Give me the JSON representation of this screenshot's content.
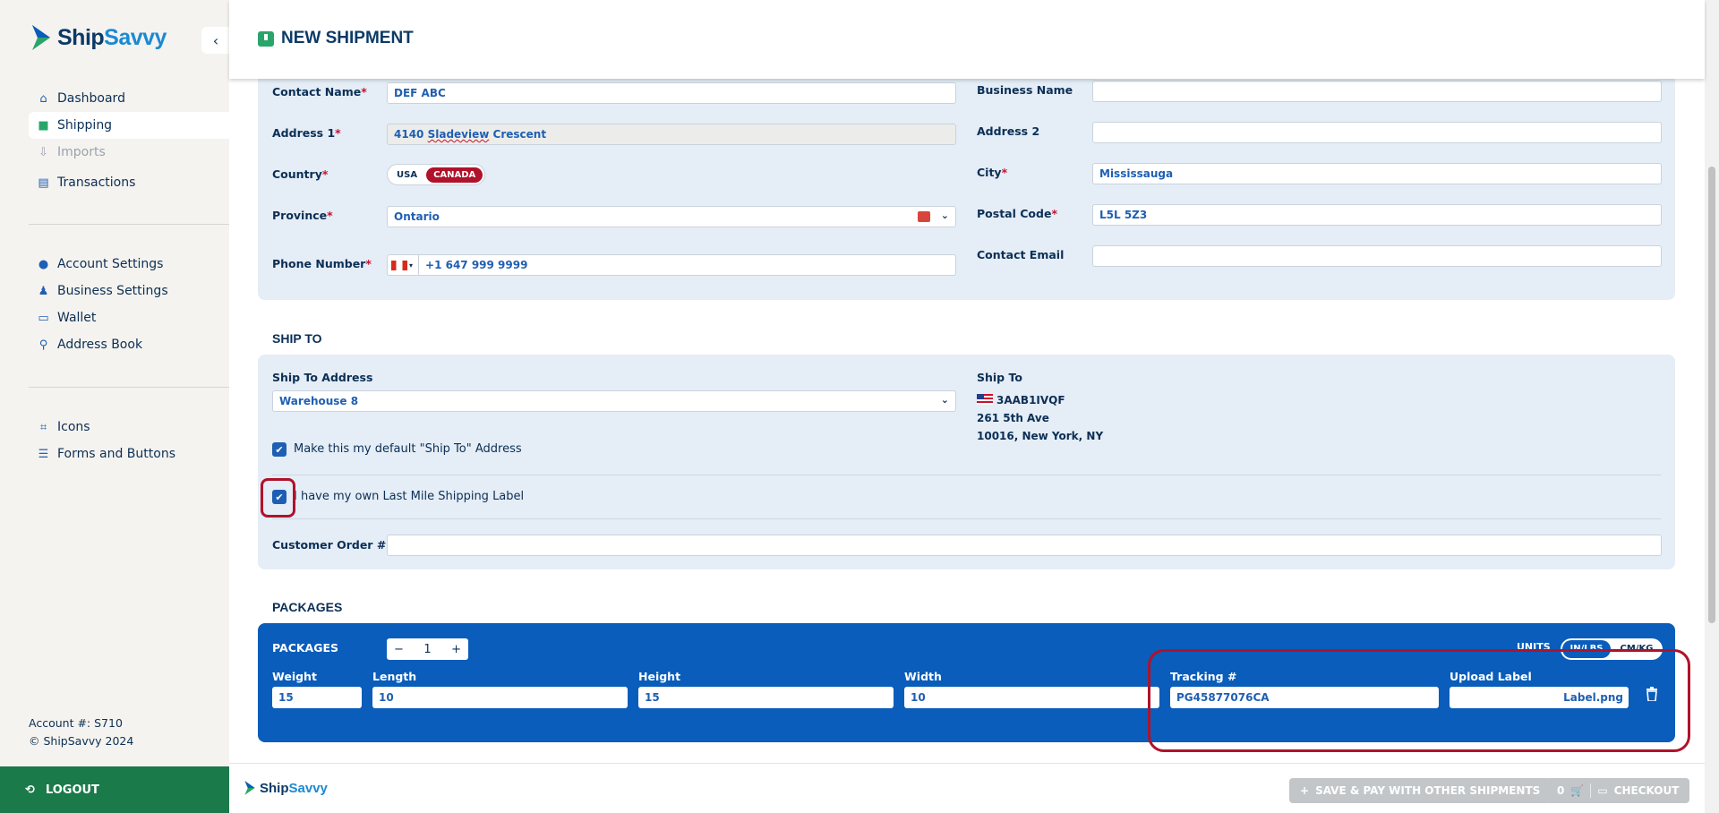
{
  "app": {
    "brand_a": "Ship",
    "brand_b": "Savvy"
  },
  "sidebar": {
    "collapse_icon": "chevron-left-icon",
    "items_main": [
      {
        "label": "Dashboard",
        "icon": "home-icon"
      },
      {
        "label": "Shipping",
        "icon": "box-icon"
      },
      {
        "label": "Imports",
        "icon": "import-icon"
      },
      {
        "label": "Transactions",
        "icon": "document-icon"
      }
    ],
    "items_settings": [
      {
        "label": "Account Settings",
        "icon": "user-circle-icon"
      },
      {
        "label": "Business Settings",
        "icon": "business-user-icon"
      },
      {
        "label": "Wallet",
        "icon": "wallet-icon"
      },
      {
        "label": "Address Book",
        "icon": "map-icon"
      }
    ],
    "items_dev": [
      {
        "label": "Icons",
        "icon": "icons-icon"
      },
      {
        "label": "Forms and Buttons",
        "icon": "list-icon"
      }
    ],
    "account_number": "Account #: S710",
    "copyright": "© ShipSavvy 2024",
    "logout_label": "LOGOUT"
  },
  "header": {
    "title": "NEW SHIPMENT"
  },
  "ship_from": {
    "contact_name_label": "Contact Name",
    "contact_name": "DEF ABC",
    "business_name_label": "Business Name",
    "business_name": "",
    "address1_label": "Address 1",
    "address1_num": "4140",
    "address1_word": "Sladeview",
    "address1_rest": "Crescent",
    "address2_label": "Address 2",
    "address2": "",
    "country_label": "Country",
    "country_options": [
      "USA",
      "CANADA"
    ],
    "country_selected": "CANADA",
    "city_label": "City",
    "city": "Mississauga",
    "province_label": "Province",
    "province": "Ontario",
    "postal_label": "Postal Code",
    "postal": "L5L 5Z3",
    "phone_label": "Phone Number",
    "phone": "+1 647 999 9999",
    "email_label": "Contact Email",
    "email": ""
  },
  "ship_to": {
    "section_title": "SHIP TO",
    "address_label": "Ship To Address",
    "address_selected": "Warehouse 8",
    "default_label": "Make this my default \"Ship To\" Address",
    "default_checked": true,
    "info_label": "Ship To",
    "info_code": "3AAB1IVQF",
    "info_street": "261 5th Ave",
    "info_city": "10016, New York, NY",
    "own_label_text": "I have my own Last Mile Shipping Label",
    "own_label_checked": true,
    "order_label": "Customer Order #",
    "order_value": ""
  },
  "packages": {
    "section_title": "PACKAGES",
    "count_label": "PACKAGES",
    "count": "1",
    "units_label": "UNITS",
    "units_options": [
      "IN/LBS",
      "CM/KG"
    ],
    "units_selected": "IN/LBS",
    "weight_label": "Weight",
    "weight": "15",
    "length_label": "Length",
    "length": "10",
    "height_label": "Height",
    "height": "15",
    "width_label": "Width",
    "width": "10",
    "tracking_label": "Tracking #",
    "tracking": "PG45877076CA",
    "upload_label": "Upload Label",
    "upload_file": "Label.png"
  },
  "footer": {
    "save_pay_label": "SAVE & PAY WITH OTHER SHIPMENTS",
    "cart_count": "0",
    "checkout_label": "CHECKOUT"
  },
  "colors": {
    "primary": "#0a5dba",
    "brand_green": "#1a7a4a",
    "accent_red": "#b0122b",
    "navy": "#0b3a66"
  }
}
